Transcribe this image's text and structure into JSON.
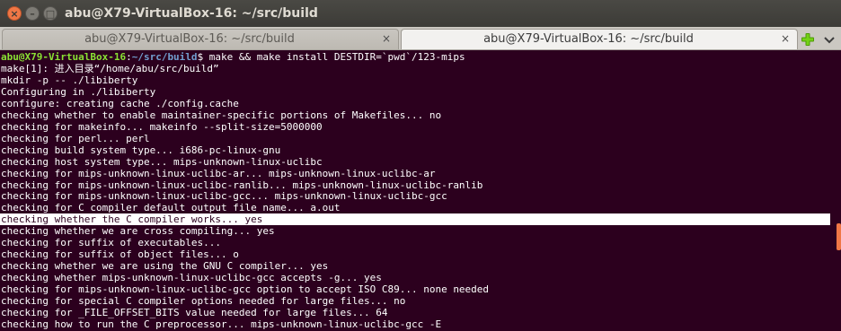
{
  "window": {
    "title": "abu@X79-VirtualBox-16: ~/src/build",
    "close_glyph": "×",
    "minimize_glyph": "–",
    "maximize_glyph": "□"
  },
  "tabs": [
    {
      "label": "abu@X79-VirtualBox-16: ~/src/build",
      "active": false,
      "close_glyph": "×"
    },
    {
      "label": "abu@X79-VirtualBox-16: ~/src/build",
      "active": true,
      "close_glyph": "×"
    }
  ],
  "colors": {
    "terminal_bg": "#2c001e",
    "prompt_user": "#8ae234",
    "prompt_path": "#729fcf",
    "accent": "#f07746",
    "new_tab_icon": "#4e9a06"
  },
  "icons": {
    "new_tab": "plus-icon",
    "tab_menu": "chevron-down-icon"
  },
  "prompt": {
    "user_host": "abu@X79-VirtualBox-16",
    "separator": ":",
    "path": "~/src/build",
    "command": "$ make && make install DESTDIR=`pwd`/123-mips"
  },
  "output_lines": [
    "make[1]: 进入目录“/home/abu/src/build”",
    "mkdir -p -- ./libiberty",
    "Configuring in ./libiberty",
    "configure: creating cache ./config.cache",
    "checking whether to enable maintainer-specific portions of Makefiles... no",
    "checking for makeinfo... makeinfo --split-size=5000000",
    "checking for perl... perl",
    "checking build system type... i686-pc-linux-gnu",
    "checking host system type... mips-unknown-linux-uclibc",
    "checking for mips-unknown-linux-uclibc-ar... mips-unknown-linux-uclibc-ar",
    "checking for mips-unknown-linux-uclibc-ranlib... mips-unknown-linux-uclibc-ranlib",
    "checking for mips-unknown-linux-uclibc-gcc... mips-unknown-linux-uclibc-gcc",
    "checking for C compiler default output file name... a.out",
    "checking whether the C compiler works... yes",
    "checking whether we are cross compiling... yes",
    "checking for suffix of executables...",
    "checking for suffix of object files... o",
    "checking whether we are using the GNU C compiler... yes",
    "checking whether mips-unknown-linux-uclibc-gcc accepts -g... yes",
    "checking for mips-unknown-linux-uclibc-gcc option to accept ISO C89... none needed",
    "checking for special C compiler options needed for large files... no",
    "checking for _FILE_OFFSET_BITS value needed for large files... 64",
    "checking how to run the C preprocessor... mips-unknown-linux-uclibc-gcc -E"
  ]
}
